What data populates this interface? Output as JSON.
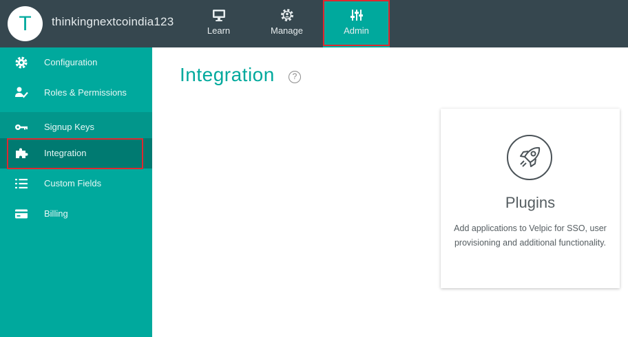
{
  "header": {
    "avatar_letter": "T",
    "org_name": "thinkingnextcoindia123",
    "tabs": [
      {
        "label": "Learn",
        "icon": "monitor-icon"
      },
      {
        "label": "Manage",
        "icon": "gear-person-icon"
      },
      {
        "label": "Admin",
        "icon": "sliders-icon",
        "active": true
      }
    ]
  },
  "sidebar": {
    "items": [
      {
        "label": "Configuration",
        "icon": "gear-icon"
      },
      {
        "label": "Roles & Permissions",
        "icon": "user-check-icon"
      },
      {
        "label": "Signup Keys",
        "icon": "key-icon"
      },
      {
        "label": "Integration",
        "icon": "puzzle-icon",
        "selected": true
      },
      {
        "label": "Custom Fields",
        "icon": "list-icon"
      },
      {
        "label": "Billing",
        "icon": "credit-card-icon"
      }
    ]
  },
  "main": {
    "title": "Integration",
    "help_symbol": "?",
    "card": {
      "title": "Plugins",
      "description": "Add applications to Velpic for SSO, user provisioning and additional functionality.",
      "icon": "rocket-icon"
    }
  },
  "colors": {
    "topbar": "#36474f",
    "accent": "#00a99d",
    "sidebar_selected": "#007a71",
    "highlight": "#e0282f"
  }
}
